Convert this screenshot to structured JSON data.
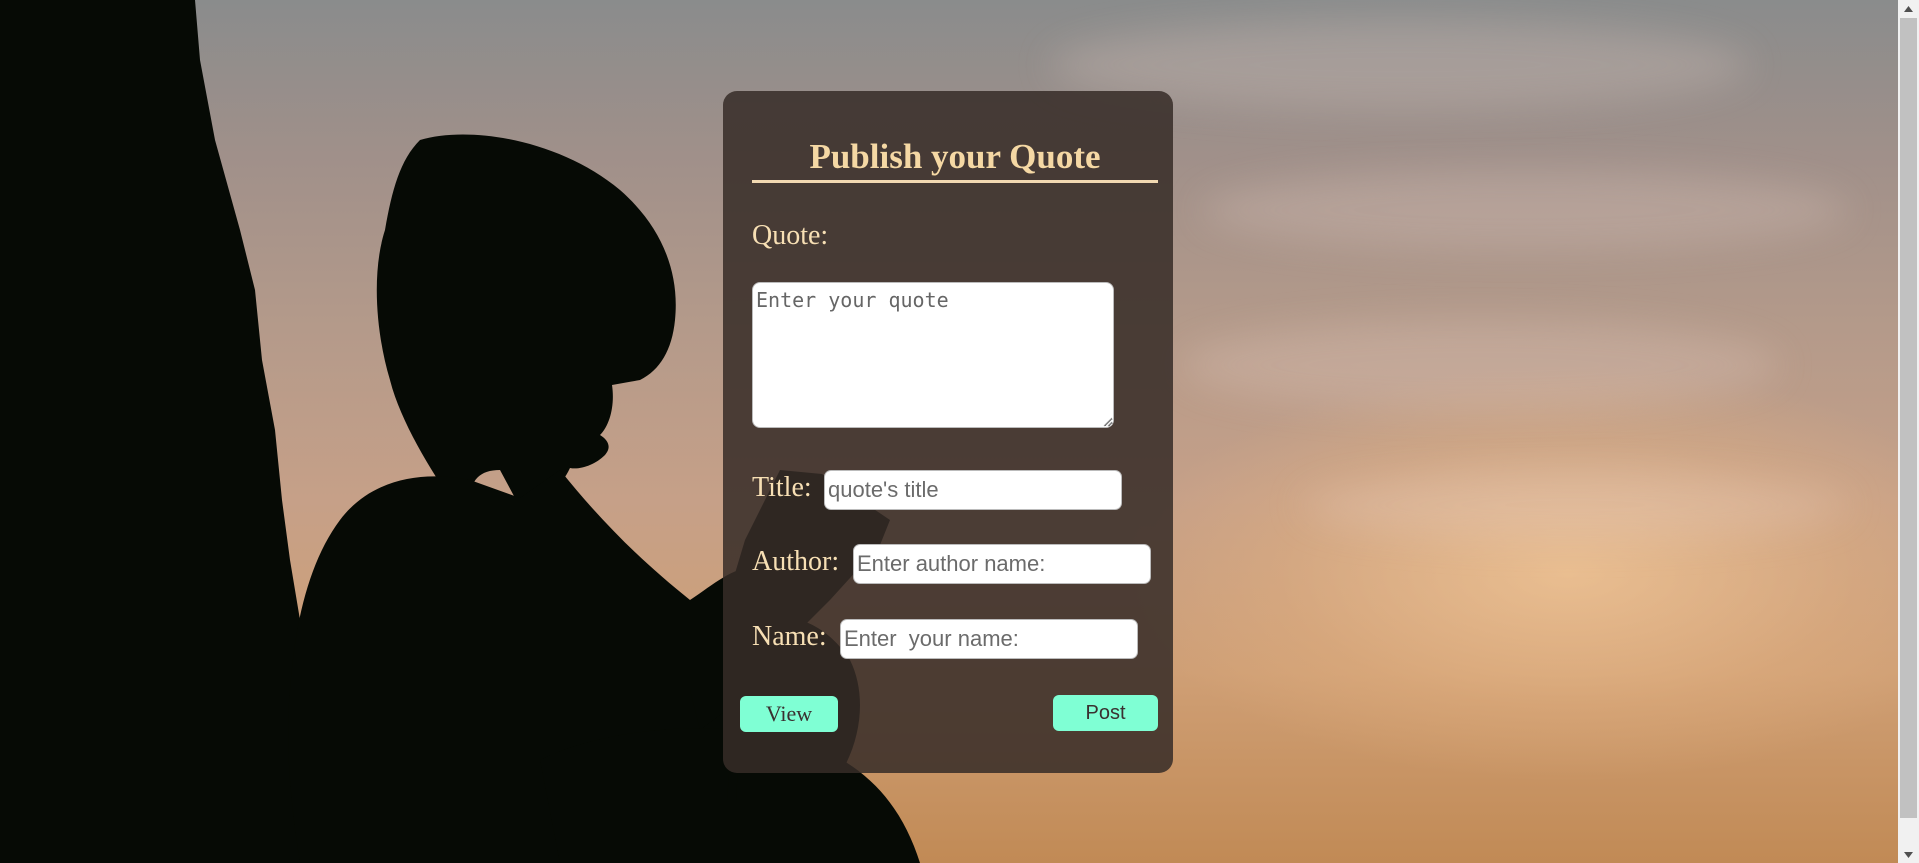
{
  "form": {
    "title": "Publish your Quote",
    "quote_label": "Quote:",
    "quote_placeholder": "Enter your quote",
    "title_label": "Title:",
    "title_placeholder": "quote's title",
    "author_label": "Author:",
    "author_placeholder": "Enter author name:",
    "name_label": "Name:",
    "name_placeholder": "Enter  your name:",
    "view_label": "View",
    "post_label": "Post"
  },
  "colors": {
    "card_text": "#f5d8a4",
    "button_bg": "#7fffd4",
    "card_bg": "#372c28"
  },
  "icons": {
    "scroll_up": "arrow-up-icon",
    "scroll_down": "arrow-down-icon",
    "resize": "resize-grip-icon"
  }
}
